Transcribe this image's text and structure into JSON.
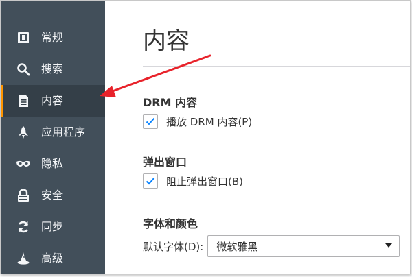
{
  "sidebar": {
    "items": [
      {
        "label": "常规",
        "icon": "general-icon",
        "active": false
      },
      {
        "label": "搜索",
        "icon": "search-icon",
        "active": false
      },
      {
        "label": "内容",
        "icon": "document-icon",
        "active": true
      },
      {
        "label": "应用程序",
        "icon": "rocket-icon",
        "active": false
      },
      {
        "label": "隐私",
        "icon": "mask-icon",
        "active": false
      },
      {
        "label": "安全",
        "icon": "lock-icon",
        "active": false
      },
      {
        "label": "同步",
        "icon": "sync-icon",
        "active": false
      },
      {
        "label": "高级",
        "icon": "wizard-hat-icon",
        "active": false
      }
    ],
    "active_accent": "#ff9500"
  },
  "main": {
    "title": "内容",
    "drm": {
      "heading": "DRM 内容",
      "checkbox_label": "播放 DRM 内容(P)",
      "checked": true
    },
    "popups": {
      "heading": "弹出窗口",
      "checkbox_label": "阻止弹出窗口(B)",
      "checked": true
    },
    "fonts": {
      "heading": "字体和颜色",
      "default_font_label": "默认字体(D):",
      "default_font_value": "微软雅黑"
    }
  },
  "annotation": {
    "color": "#e8232b"
  }
}
